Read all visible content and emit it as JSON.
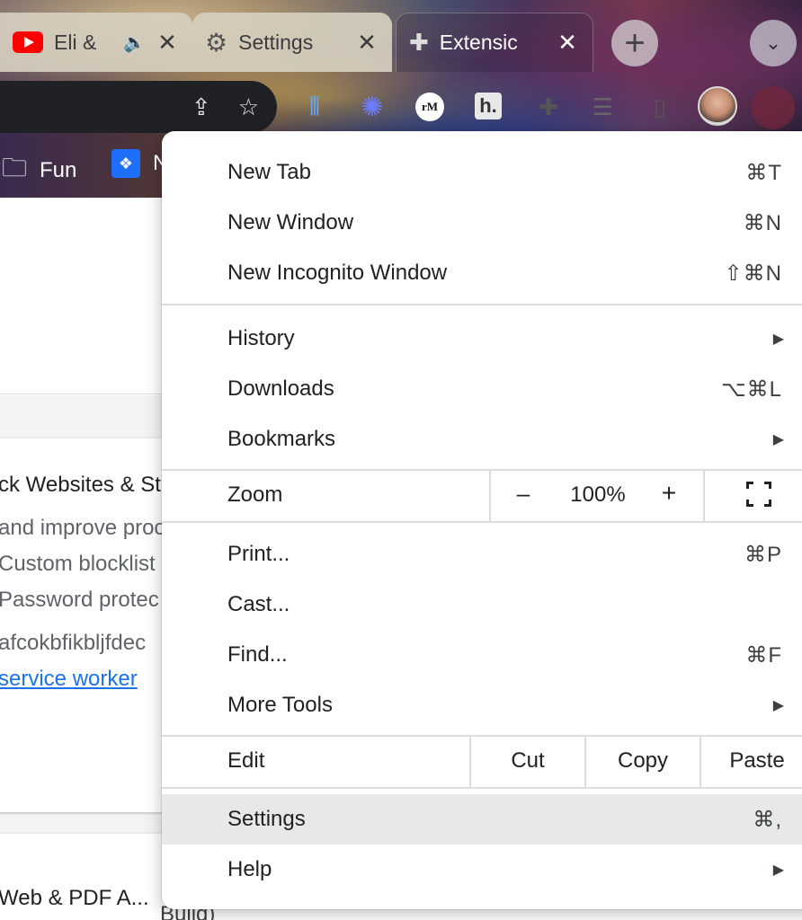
{
  "tabs": [
    {
      "title": "Eli &",
      "icon": "youtube-icon",
      "audio": "audio-playing-icon",
      "close": "✕"
    },
    {
      "title": "Settings",
      "icon": "gear-icon",
      "close": "✕"
    },
    {
      "title": "Extensic",
      "icon": "puzzle-icon",
      "close": "✕"
    }
  ],
  "toolbar": {
    "new_tab": "+",
    "tab_search": "⌄",
    "share_icon": "⇪",
    "star_icon": "☆",
    "extensions": {
      "rm": "rM",
      "h": "h."
    }
  },
  "bookmarks": [
    {
      "label": "Fun",
      "icon": "folder-icon"
    },
    {
      "label": "N",
      "icon": "dropbox-icon"
    }
  ],
  "page": {
    "title": "ck Websites & St",
    "desc1": "and improve proc",
    "desc2": "Custom blocklist",
    "desc3": "Password protec",
    "ext_id": "afcokbfikbljfdec",
    "service_worker": "service worker",
    "card2_title": "Web & PDF A...",
    "card2_sub": "Build)"
  },
  "menu": {
    "items": [
      {
        "label": "New Tab",
        "shortcut": "⌘T"
      },
      {
        "label": "New Window",
        "shortcut": "⌘N"
      },
      {
        "label": "New Incognito Window",
        "shortcut": "⇧⌘N"
      },
      {
        "label": "History",
        "arrow": "▶"
      },
      {
        "label": "Downloads",
        "shortcut": "⌥⌘L"
      },
      {
        "label": "Bookmarks",
        "arrow": "▶"
      },
      {
        "label": "Print...",
        "shortcut": "⌘P"
      },
      {
        "label": "Cast..."
      },
      {
        "label": "Find...",
        "shortcut": "⌘F"
      },
      {
        "label": "More Tools",
        "arrow": "▶"
      },
      {
        "label": "Settings",
        "shortcut": "⌘,"
      },
      {
        "label": "Help",
        "arrow": "▶"
      }
    ],
    "zoom": {
      "label": "Zoom",
      "minus": "–",
      "value": "100%",
      "plus": "+"
    },
    "edit": {
      "label": "Edit",
      "cut": "Cut",
      "copy": "Copy",
      "paste": "Paste"
    }
  }
}
